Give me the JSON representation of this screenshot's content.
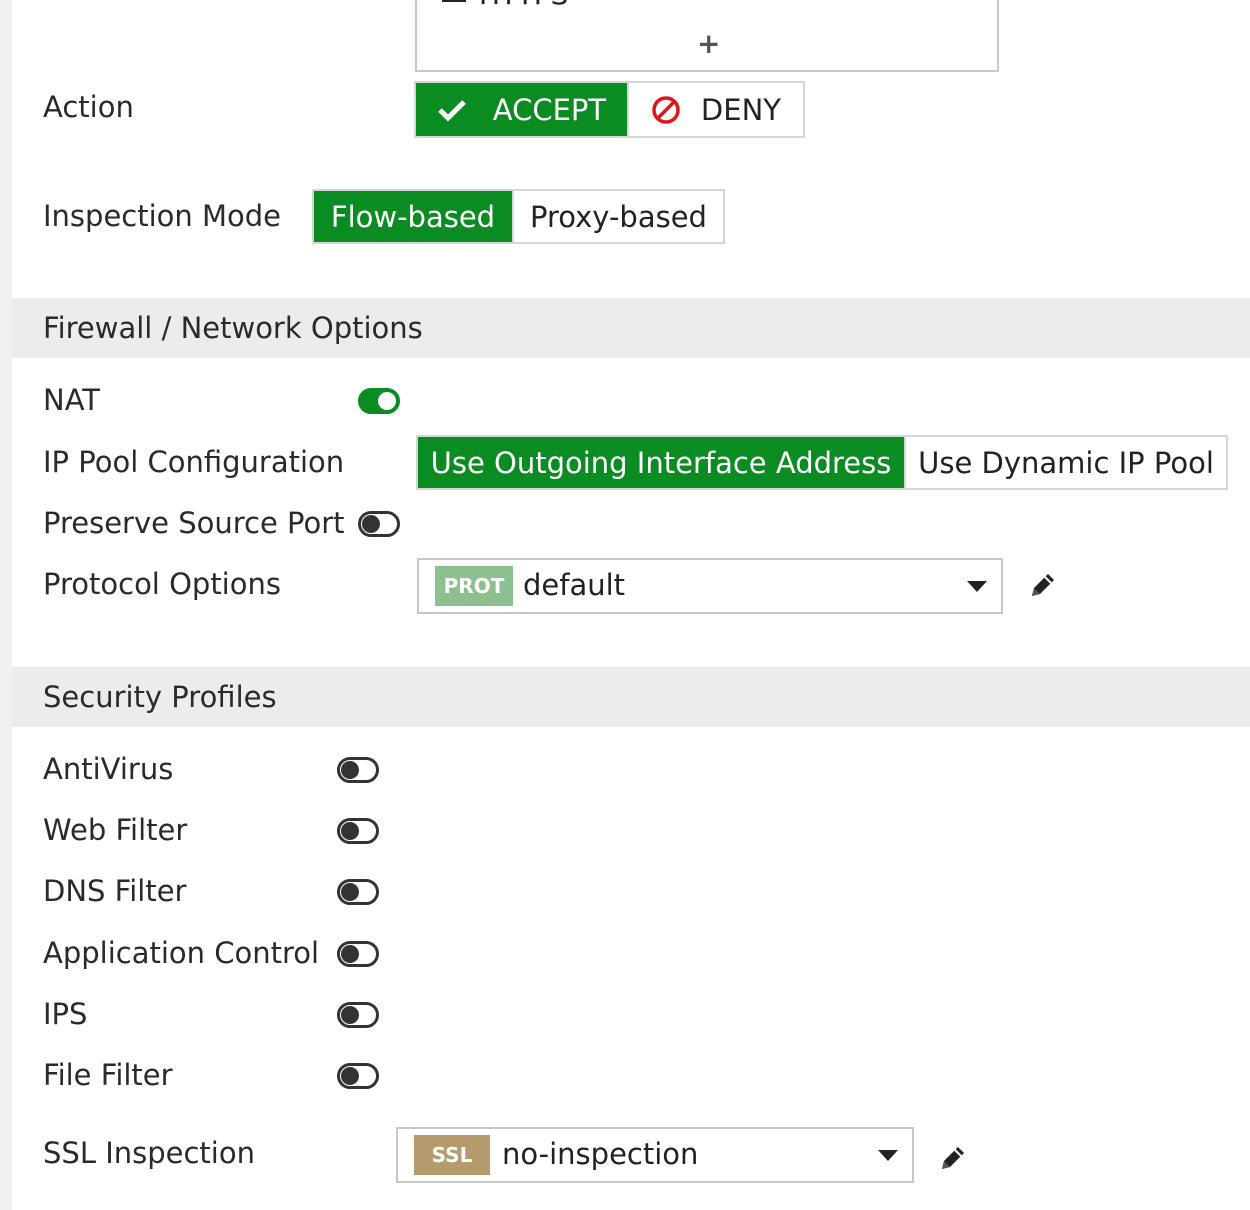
{
  "services": {
    "item_label": "HTTPS",
    "remove_icon": "close-icon",
    "add_icon": "plus-icon",
    "add_label": "+"
  },
  "action": {
    "label": "Action",
    "options": [
      {
        "label": "ACCEPT",
        "icon": "check-icon",
        "selected": true
      },
      {
        "label": "DENY",
        "icon": "deny-icon",
        "selected": false
      }
    ]
  },
  "inspection_mode": {
    "label": "Inspection Mode",
    "options": [
      {
        "label": "Flow-based",
        "selected": true
      },
      {
        "label": "Proxy-based",
        "selected": false
      }
    ]
  },
  "firewall_network_options": {
    "title": "Firewall / Network Options",
    "nat": {
      "label": "NAT",
      "enabled": true
    },
    "ip_pool": {
      "label": "IP Pool Configuration",
      "options": [
        {
          "label": "Use Outgoing Interface Address",
          "selected": true
        },
        {
          "label": "Use Dynamic IP Pool",
          "selected": false
        }
      ]
    },
    "preserve_source_port": {
      "label": "Preserve Source Port",
      "enabled": false
    },
    "protocol_options": {
      "label": "Protocol Options",
      "tag": "PROT",
      "value": "default"
    }
  },
  "security_profiles": {
    "title": "Security Profiles",
    "items": [
      {
        "label": "AntiVirus",
        "enabled": false
      },
      {
        "label": "Web Filter",
        "enabled": false
      },
      {
        "label": "DNS Filter",
        "enabled": false
      },
      {
        "label": "Application Control",
        "enabled": false
      },
      {
        "label": "IPS",
        "enabled": false
      },
      {
        "label": "File Filter",
        "enabled": false
      }
    ],
    "ssl_inspection": {
      "label": "SSL Inspection",
      "tag": "SSL",
      "value": "no-inspection"
    }
  },
  "colors": {
    "accent_green": "#0a8c23",
    "deny_red": "#e0161b",
    "prot_tag": "#8cc08e",
    "ssl_tag": "#b49a6c",
    "section_bg": "#ececec"
  }
}
